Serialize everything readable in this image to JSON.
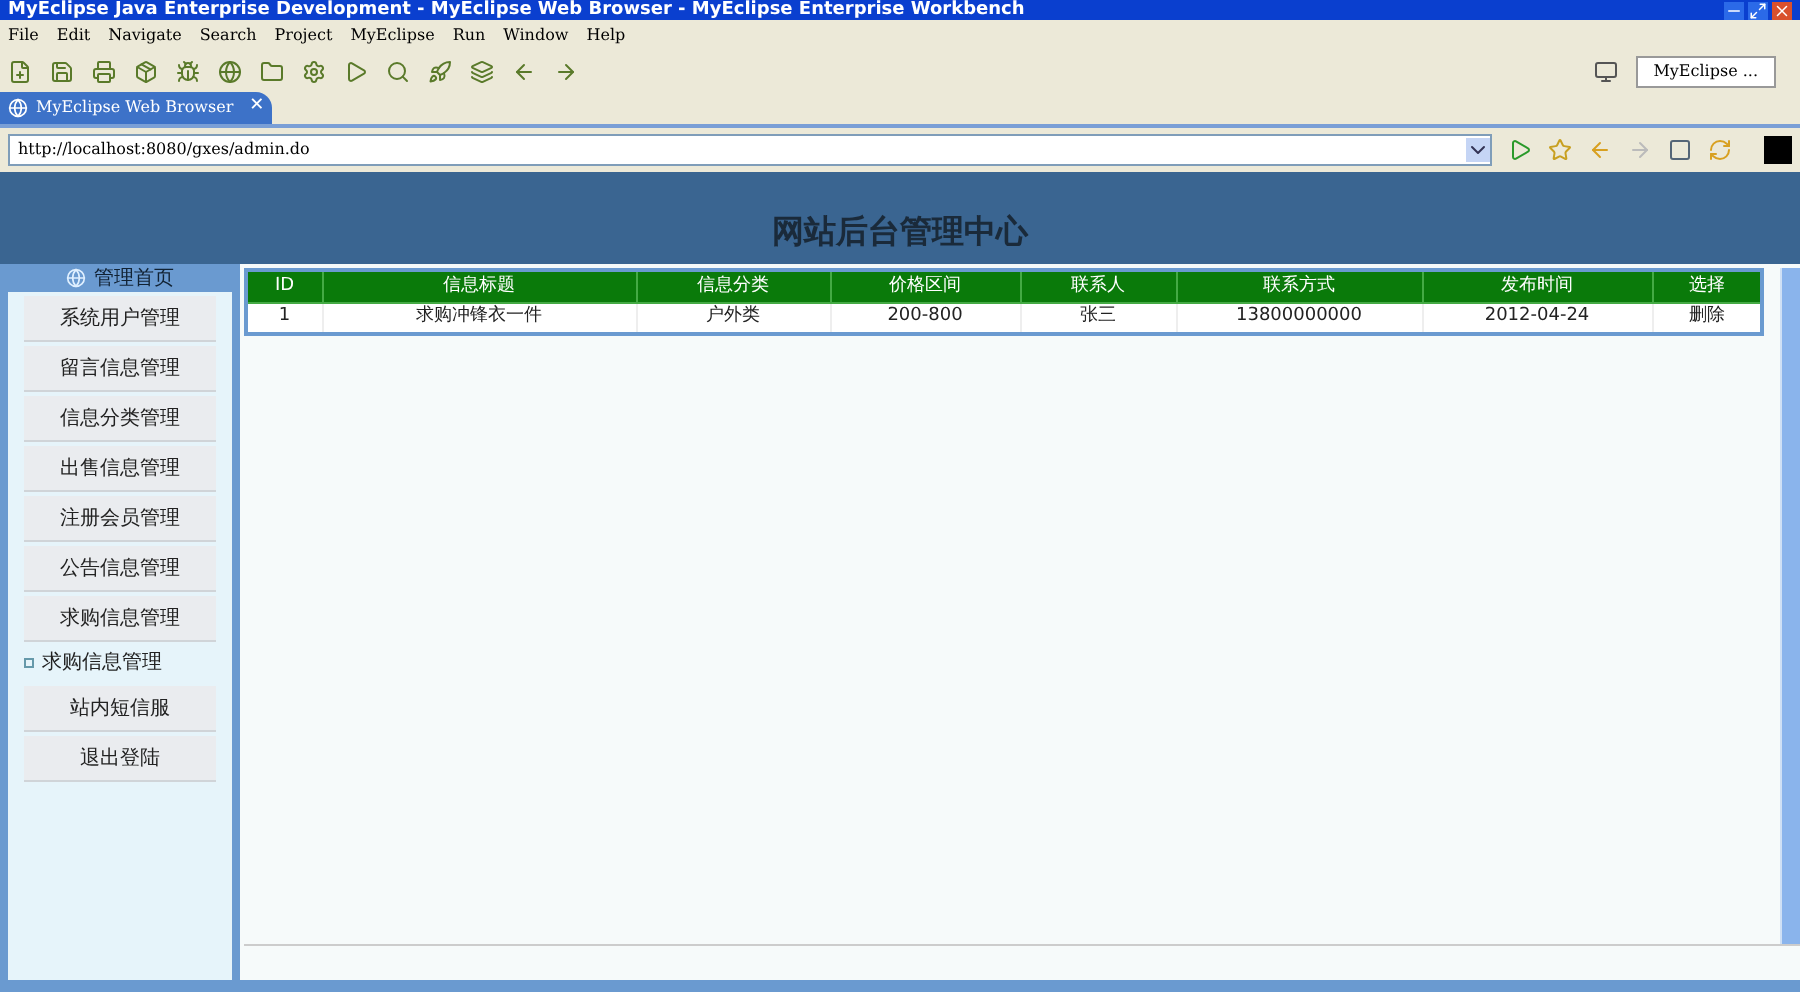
{
  "window": {
    "title": "MyEclipse Java Enterprise Development - MyEclipse Web Browser - MyEclipse Enterprise Workbench"
  },
  "menu": [
    "File",
    "Edit",
    "Navigate",
    "Search",
    "Project",
    "MyEclipse",
    "Run",
    "Window",
    "Help"
  ],
  "perspective": {
    "label": "MyEclipse ..."
  },
  "editor_tab": {
    "label": "MyEclipse Web Browser",
    "close": "✕"
  },
  "address": {
    "value": "http://localhost:8080/gxes/admin.do"
  },
  "page": {
    "title": "网站后台管理中心",
    "sidebar": {
      "heading": "管理首页",
      "items": [
        {
          "label": "系统用户管理",
          "kind": "button"
        },
        {
          "label": "留言信息管理",
          "kind": "button"
        },
        {
          "label": "信息分类管理",
          "kind": "button"
        },
        {
          "label": "出售信息管理",
          "kind": "button"
        },
        {
          "label": "注册会员管理",
          "kind": "button"
        },
        {
          "label": "公告信息管理",
          "kind": "button"
        },
        {
          "label": "求购信息管理",
          "kind": "button"
        },
        {
          "label": "求购信息管理",
          "kind": "link"
        },
        {
          "label": "站内短信服",
          "kind": "button"
        },
        {
          "label": "退出登陆",
          "kind": "button"
        }
      ]
    },
    "table": {
      "columns": [
        "ID",
        "信息标题",
        "信息分类",
        "价格区间",
        "联系人",
        "联系方式",
        "发布时间",
        "选择"
      ],
      "rows": [
        [
          "1",
          "求购冲锋衣一件",
          "户外类",
          "200-800",
          "张三",
          "13800000000",
          "2012-04-24",
          "删除"
        ]
      ]
    }
  }
}
